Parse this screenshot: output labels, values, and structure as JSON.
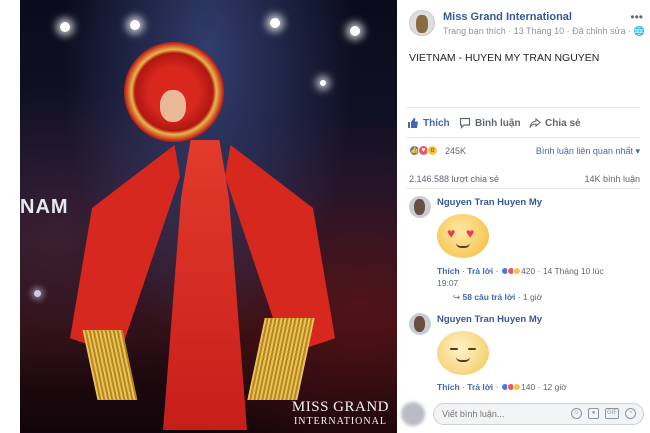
{
  "photo": {
    "background_text": "NAM",
    "watermark_line1": "MISS GRAND",
    "watermark_line2": "INTERNATIONAL"
  },
  "post": {
    "page_name": "Miss Grand International",
    "subtitle": "Trang bạn thích · 13 Tháng 10 · Đã chỉnh sửa · 🌐",
    "caption": "VIETNAM - HUYEN MY TRAN NGUYEN",
    "actions": {
      "like": "Thích",
      "comment": "Bình luận",
      "share": "Chia sẻ"
    },
    "reactions_count": "245K",
    "relevance_filter": "Bình luận liên quan nhất ▾",
    "shares": "2.146.588 lượt chia sẻ",
    "comment_count": "14K bình luận",
    "accent_color": "#4267b2"
  },
  "comments": [
    {
      "author": "Nguyen Tran Huyen My",
      "sticker": "heart-eyes",
      "like": "Thích",
      "reply": "Trả lời",
      "reactions": "420",
      "time_line1": "14 Tháng 10 lúc",
      "time_line2": "19:07",
      "replies": "58 câu trả lời",
      "replies_time": "1 giờ"
    },
    {
      "author": "Nguyen Tran Huyen My",
      "sticker": "smile",
      "like": "Thích",
      "reply": "Trả lời",
      "reactions": "140",
      "time_line1": "12 giờ"
    }
  ],
  "composer": {
    "placeholder": "Viết bình luận...",
    "icons": [
      "emoji-icon",
      "camera-icon",
      "gif-icon",
      "sticker-icon"
    ]
  }
}
